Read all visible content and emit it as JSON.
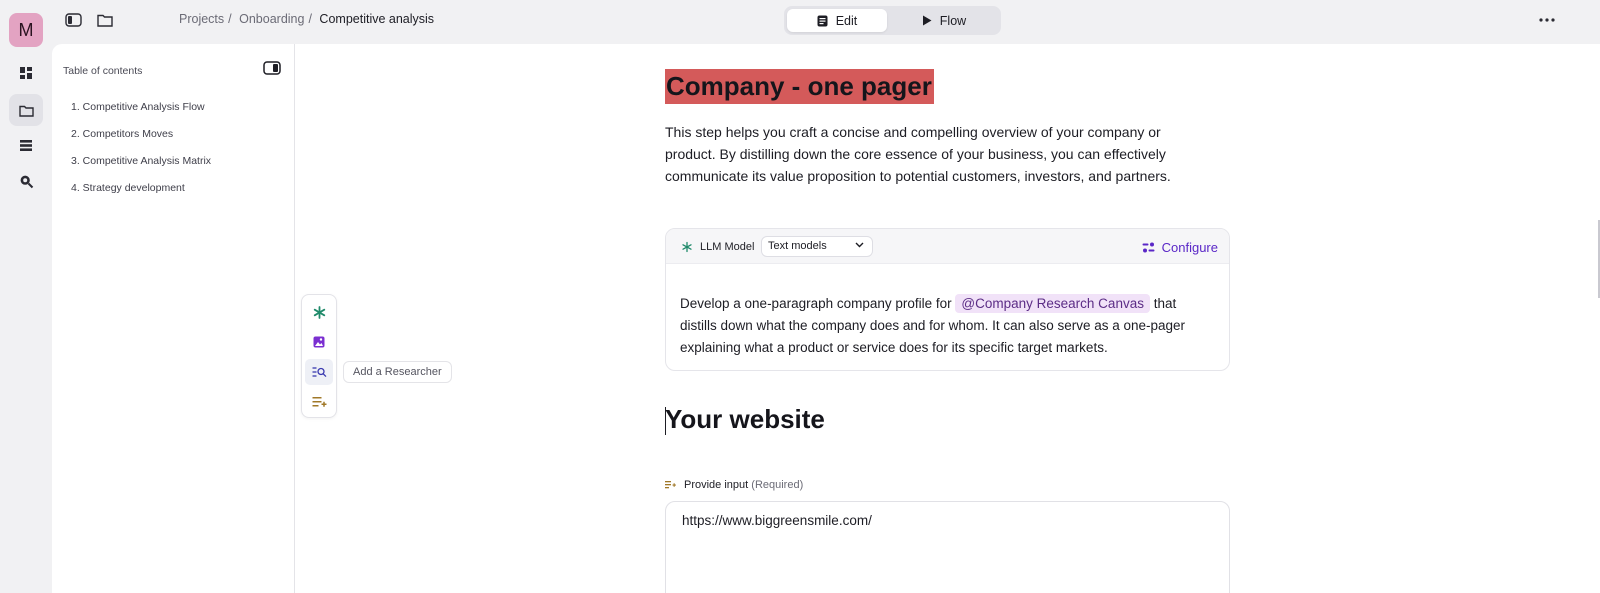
{
  "rail": {
    "avatar_letter": "M",
    "items": [
      {
        "icon": "dashboard-icon"
      },
      {
        "icon": "folder-icon",
        "active": true
      },
      {
        "icon": "list-icon"
      },
      {
        "icon": "search-icon"
      }
    ]
  },
  "topbar": {
    "breadcrumb": {
      "projects": "Projects",
      "onboarding": "Onboarding",
      "current": "Competitive analysis",
      "separator": "/"
    },
    "modes": {
      "edit": "Edit",
      "flow": "Flow",
      "active": "Edit"
    }
  },
  "toc": {
    "title": "Table of contents",
    "items": [
      "1. Competitive Analysis Flow",
      "2. Competitors Moves",
      "3. Competitive Analysis Matrix",
      "4. Strategy development"
    ]
  },
  "doc": {
    "heading1": "Company - one pager",
    "intro": "This step helps you craft a concise and compelling overview of your company or product. By distilling down the core essence of your business, you can effectively communicate its value proposition to potential customers, investors, and partners.",
    "llm": {
      "label": "LLM Model",
      "select_value": "Text models",
      "configure": "Configure",
      "prompt_before": "Develop a one-paragraph company profile for ",
      "mention": "@Company Research Canvas",
      "prompt_after": " that distills down what the company does and for whom. It can also serve as a one-pager explaining what a product or service does for its specific target markets."
    },
    "heading2": "Your website",
    "input": {
      "label": "Provide input",
      "required": "(Required)",
      "value": "https://www.biggreensmile.com/"
    }
  },
  "block_toolbar": {
    "items": [
      "ai-sparkle-icon",
      "image-icon",
      "researcher-icon",
      "add-input-icon"
    ],
    "tooltip": "Add a Researcher"
  },
  "colors": {
    "accent": "#5a27c7",
    "heading_highlight": "#d45a5a",
    "avatar": "#e3a3c2",
    "mention_bg": "#f1e2f8",
    "ai_green": "#1f8a6a"
  }
}
